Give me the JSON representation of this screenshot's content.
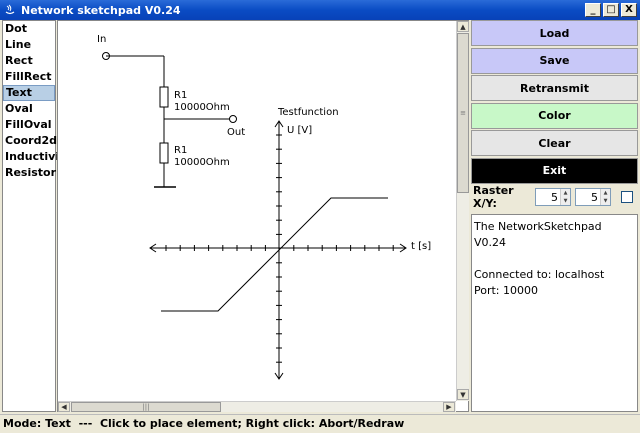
{
  "window": {
    "title": "Network sketchpad V0.24",
    "minimize": "_",
    "maximize": "□",
    "close": "X"
  },
  "tools": [
    {
      "label": "Dot"
    },
    {
      "label": "Line"
    },
    {
      "label": "Rect"
    },
    {
      "label": "FillRect"
    },
    {
      "label": "Text",
      "selected": true
    },
    {
      "label": "Oval"
    },
    {
      "label": "FillOval"
    },
    {
      "label": "Coord2d"
    },
    {
      "label": "Inductivity"
    },
    {
      "label": "Resistor"
    }
  ],
  "canvas": {
    "in_label": "In",
    "out_label": "Out",
    "r1_top_name": "R1",
    "r1_top_value": "10000Ohm",
    "r1_bottom_name": "R1",
    "r1_bottom_value": "10000Ohm",
    "graph_title": "Testfunction",
    "y_axis_label": "U [V]",
    "x_axis_label": "t [s]"
  },
  "buttons": {
    "load": {
      "label": "Load",
      "color": "#c8c8f8"
    },
    "save": {
      "label": "Save",
      "color": "#c8c8f8"
    },
    "retransmit": {
      "label": "Retransmit",
      "color": "#e6e6e6"
    },
    "color": {
      "label": "Color",
      "color": "#c8f8c8"
    },
    "clear": {
      "label": "Clear",
      "color": "#e6e6e6"
    },
    "exit": {
      "label": "Exit",
      "color": "#000000"
    }
  },
  "raster": {
    "label": "Raster X/Y:",
    "x": "5",
    "y": "5",
    "checked": false
  },
  "info": {
    "line1": "The NetworkSketchpad V0.24",
    "line2": "",
    "line3": "Connected to: localhost",
    "line4": "Port: 10000"
  },
  "status": {
    "text": "Mode: Text  ---  Click to place element; Right click: Abort/Redraw"
  },
  "colors": {
    "titlebar": "#0a4cc4",
    "selection": "#b8cfe5"
  }
}
